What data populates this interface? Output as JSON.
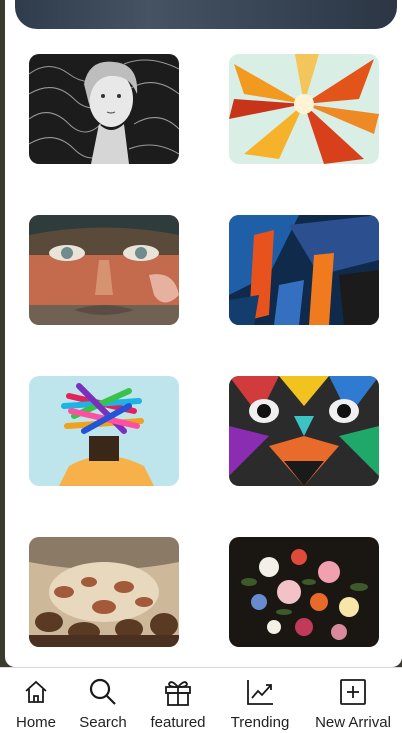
{
  "banner": {},
  "gallery": {
    "items": [
      {
        "art": "sketch-woman-portrait"
      },
      {
        "art": "abstract-orange-flower"
      },
      {
        "art": "graffiti-face-mural"
      },
      {
        "art": "blue-orange-abstract-painting"
      },
      {
        "art": "colorful-scribble-head"
      },
      {
        "art": "geometric-face-mural"
      },
      {
        "art": "baroque-ceiling-fresco"
      },
      {
        "art": "dark-floral-still-life"
      }
    ]
  },
  "nav": {
    "items": [
      {
        "label": "Home",
        "icon": "home-icon"
      },
      {
        "label": "Search",
        "icon": "search-icon"
      },
      {
        "label": "featured",
        "icon": "gift-icon"
      },
      {
        "label": "Trending",
        "icon": "trending-icon"
      },
      {
        "label": "New Arrival",
        "icon": "add-box-icon"
      }
    ]
  }
}
